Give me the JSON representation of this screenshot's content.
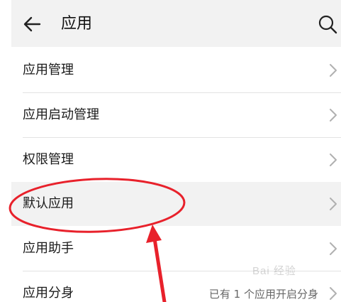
{
  "header": {
    "title": "应用",
    "back_icon": "arrow-left-icon",
    "search_icon": "search-icon"
  },
  "rows": [
    {
      "label": "应用管理",
      "value": ""
    },
    {
      "label": "应用启动管理",
      "value": ""
    },
    {
      "label": "权限管理",
      "value": ""
    },
    {
      "label": "默认应用",
      "value": ""
    },
    {
      "label": "应用助手",
      "value": ""
    },
    {
      "label": "应用分身",
      "value": "已有 1 个应用开启分身"
    }
  ],
  "watermark": {
    "text": "Bai 经验"
  },
  "colors": {
    "header_bg": "#f2f2f2",
    "highlight_row_bg": "#f2f2f2",
    "annotation_red": "#e8212b",
    "chevron": "#b0b0b0"
  }
}
